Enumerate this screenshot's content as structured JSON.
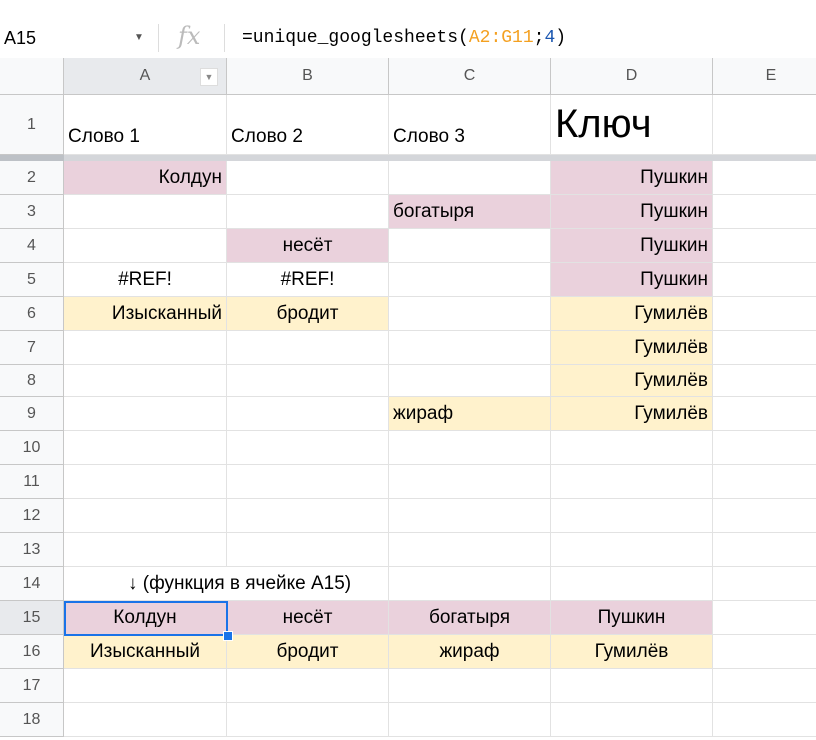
{
  "name_box": "A15",
  "formula": {
    "prefix": "=unique_googlesheets(",
    "ref": "A2:G11",
    "sep": ";",
    "arg": "4",
    "suffix": ")"
  },
  "fx_label": "fx",
  "columns": [
    "A",
    "B",
    "C",
    "D",
    "E"
  ],
  "rows": [
    {
      "n": "1",
      "cells": [
        {
          "t": "Слово 1",
          "a": "bl"
        },
        {
          "t": "Слово 2",
          "a": "bl"
        },
        {
          "t": "Слово 3",
          "a": "bl"
        },
        {
          "t": "Ключ",
          "a": "big"
        },
        {
          "t": ""
        }
      ]
    },
    {
      "n": "2",
      "cells": [
        {
          "t": "Колдун",
          "a": "r",
          "bg": "pink"
        },
        {
          "t": ""
        },
        {
          "t": ""
        },
        {
          "t": "Пушкин",
          "a": "r",
          "bg": "pink"
        },
        {
          "t": ""
        }
      ]
    },
    {
      "n": "3",
      "cells": [
        {
          "t": ""
        },
        {
          "t": ""
        },
        {
          "t": "богатыря",
          "a": "l",
          "bg": "pink"
        },
        {
          "t": "Пушкин",
          "a": "r",
          "bg": "pink"
        },
        {
          "t": ""
        }
      ]
    },
    {
      "n": "4",
      "cells": [
        {
          "t": ""
        },
        {
          "t": "несёт",
          "a": "c",
          "bg": "pink"
        },
        {
          "t": ""
        },
        {
          "t": "Пушкин",
          "a": "r",
          "bg": "pink"
        },
        {
          "t": ""
        }
      ]
    },
    {
      "n": "5",
      "cells": [
        {
          "t": "#REF!",
          "a": "c"
        },
        {
          "t": "#REF!",
          "a": "c"
        },
        {
          "t": ""
        },
        {
          "t": "Пушкин",
          "a": "r",
          "bg": "pink"
        },
        {
          "t": ""
        }
      ]
    },
    {
      "n": "6",
      "cells": [
        {
          "t": "Изысканный",
          "a": "r",
          "bg": "yellow"
        },
        {
          "t": "бродит",
          "a": "c",
          "bg": "yellow"
        },
        {
          "t": ""
        },
        {
          "t": "Гумилёв",
          "a": "r",
          "bg": "yellow"
        },
        {
          "t": ""
        }
      ]
    },
    {
      "n": "7",
      "cells": [
        {
          "t": ""
        },
        {
          "t": ""
        },
        {
          "t": ""
        },
        {
          "t": "Гумилёв",
          "a": "r",
          "bg": "yellow"
        },
        {
          "t": ""
        }
      ]
    },
    {
      "n": "8",
      "cells": [
        {
          "t": ""
        },
        {
          "t": ""
        },
        {
          "t": ""
        },
        {
          "t": "Гумилёв",
          "a": "r",
          "bg": "yellow"
        },
        {
          "t": ""
        }
      ]
    },
    {
      "n": "9",
      "cells": [
        {
          "t": ""
        },
        {
          "t": ""
        },
        {
          "t": "жираф",
          "a": "l",
          "bg": "yellow"
        },
        {
          "t": "Гумилёв",
          "a": "r",
          "bg": "yellow"
        },
        {
          "t": ""
        }
      ]
    },
    {
      "n": "10",
      "cells": [
        {
          "t": ""
        },
        {
          "t": ""
        },
        {
          "t": ""
        },
        {
          "t": ""
        },
        {
          "t": ""
        }
      ]
    },
    {
      "n": "11",
      "cells": [
        {
          "t": ""
        },
        {
          "t": ""
        },
        {
          "t": ""
        },
        {
          "t": ""
        },
        {
          "t": ""
        }
      ]
    },
    {
      "n": "12",
      "cells": [
        {
          "t": ""
        },
        {
          "t": ""
        },
        {
          "t": ""
        },
        {
          "t": ""
        },
        {
          "t": ""
        }
      ]
    },
    {
      "n": "13",
      "cells": [
        {
          "t": ""
        },
        {
          "t": ""
        },
        {
          "t": ""
        },
        {
          "t": ""
        },
        {
          "t": ""
        }
      ]
    },
    {
      "n": "14",
      "cells": [
        {
          "t": "↓ (функция в ячейке A15)",
          "a": "ov"
        },
        {
          "t": ""
        },
        {
          "t": ""
        },
        {
          "t": ""
        },
        {
          "t": ""
        }
      ]
    },
    {
      "n": "15",
      "cells": [
        {
          "t": "Колдун",
          "a": "c",
          "bg": "pink"
        },
        {
          "t": "несёт",
          "a": "c",
          "bg": "pink"
        },
        {
          "t": "богатыря",
          "a": "c",
          "bg": "pink"
        },
        {
          "t": "Пушкин",
          "a": "c",
          "bg": "pink"
        },
        {
          "t": ""
        }
      ]
    },
    {
      "n": "16",
      "cells": [
        {
          "t": "Изысканный",
          "a": "c",
          "bg": "yellow"
        },
        {
          "t": "бродит",
          "a": "c",
          "bg": "yellow"
        },
        {
          "t": "жираф",
          "a": "c",
          "bg": "yellow"
        },
        {
          "t": "Гумилёв",
          "a": "c",
          "bg": "yellow"
        },
        {
          "t": ""
        }
      ]
    },
    {
      "n": "17",
      "cells": [
        {
          "t": ""
        },
        {
          "t": ""
        },
        {
          "t": ""
        },
        {
          "t": ""
        },
        {
          "t": ""
        }
      ]
    },
    {
      "n": "18",
      "cells": [
        {
          "t": ""
        },
        {
          "t": ""
        },
        {
          "t": ""
        },
        {
          "t": ""
        },
        {
          "t": ""
        }
      ]
    }
  ],
  "colors": {
    "pink": "#ead1dc",
    "yellow": "#fff2cc",
    "selection": "#1a73e8"
  }
}
